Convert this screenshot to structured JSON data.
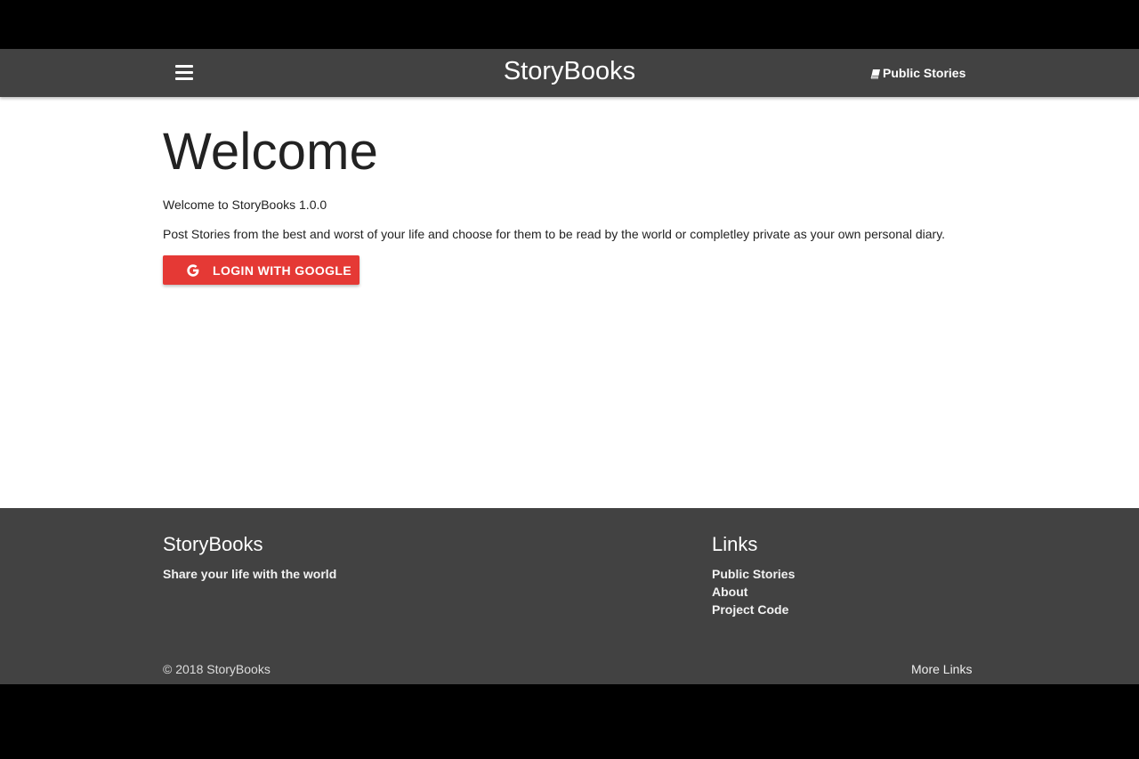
{
  "navbar": {
    "menu_icon": "hamburger-icon",
    "brand": "StoryBooks",
    "public_stories_icon": "book-icon",
    "public_stories_label": "Public Stories"
  },
  "main": {
    "title": "Welcome",
    "version_text": "Welcome to StoryBooks 1.0.0",
    "description": "Post Stories from the best and worst of your life and choose for them to be read by the world or completley private as your own personal diary.",
    "login_button": {
      "icon": "google-icon",
      "label": "LOGIN WITH GOOGLE"
    }
  },
  "footer": {
    "brand_heading": "StoryBooks",
    "tagline": "Share your life with the world",
    "links_heading": "Links",
    "links": [
      "Public Stories",
      "About",
      "Project Code"
    ],
    "copyright": "© 2018 StoryBooks",
    "more_links": "More Links"
  },
  "colors": {
    "navbar_bg": "#424242",
    "footer_bg": "#424242",
    "login_button_bg": "#e53935",
    "page_bg": "#ffffff"
  }
}
